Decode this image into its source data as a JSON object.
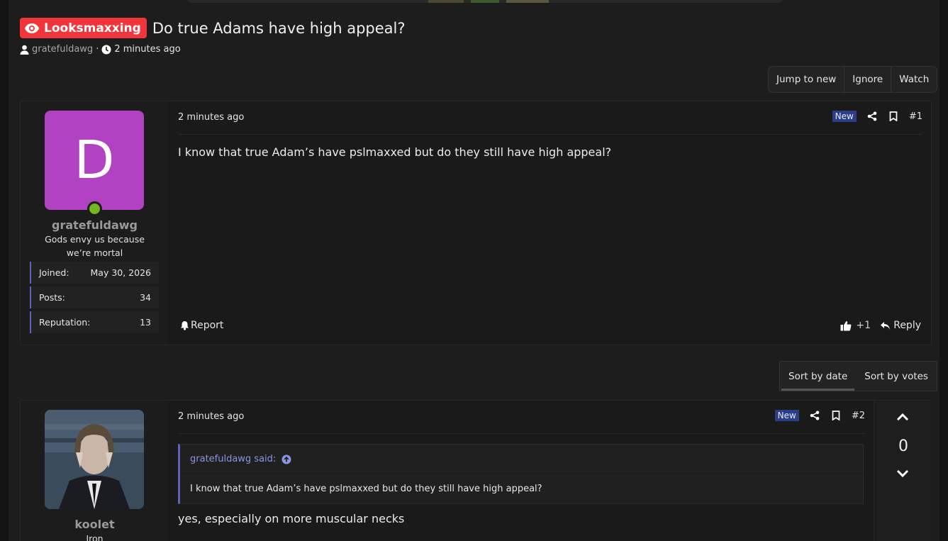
{
  "thread": {
    "prefix": "Looksmaxxing",
    "title": "Do true Adams have high appeal?",
    "author": "gratefuldawg",
    "time": "2 minutes ago"
  },
  "actions": {
    "jump_to_new": "Jump to new",
    "ignore": "Ignore",
    "watch": "Watch"
  },
  "sort": {
    "by_date": "Sort by date",
    "by_votes": "Sort by votes"
  },
  "posts": [
    {
      "avatar_letter": "D",
      "username": "gratefuldawg",
      "user_title": "Gods envy us because we’re mortal",
      "stats": [
        {
          "label": "Joined:",
          "value": "May 30, 2026"
        },
        {
          "label": "Posts:",
          "value": "34"
        },
        {
          "label": "Reputation:",
          "value": "13"
        }
      ],
      "time": "2 minutes ago",
      "badge": "New",
      "number": "#1",
      "body": "I know that true Adam’s have pslmaxxed but do they still have high appeal?",
      "report": "Report",
      "likes": "+1",
      "reply": "Reply"
    },
    {
      "username": "koolet",
      "user_title": "Iron",
      "time": "2 minutes ago",
      "badge": "New",
      "number": "#2",
      "quote_author": "gratefuldawg said:",
      "quote_text": "I know that true Adam’s have pslmaxxed but do they still have high appeal?",
      "body": "yes, especially on more muscular necks",
      "votes": "0"
    }
  ],
  "colors": {
    "prefix_bg": "#f1353b",
    "avatar_bg": "#b142c1",
    "online": "#74b620",
    "new_badge": "#2b3e86",
    "stat_accent": "#5b64b8"
  }
}
